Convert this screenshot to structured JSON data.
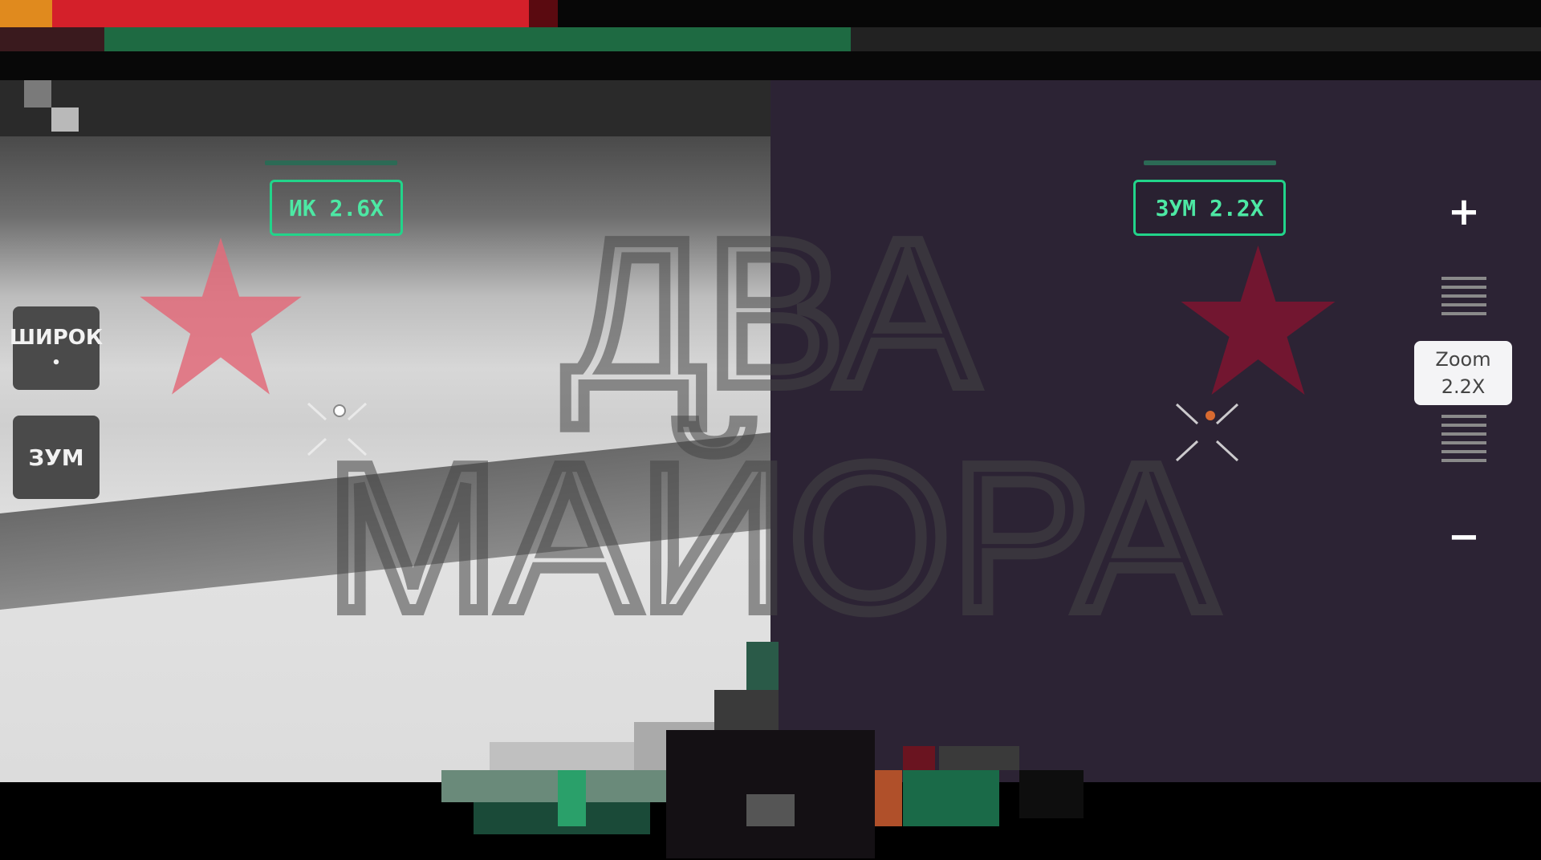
{
  "left_view": {
    "mode_label": "ИК 2.6X",
    "buttons": [
      {
        "label": "ШИРОК",
        "indicator": "•"
      },
      {
        "label": "ЗУМ"
      }
    ]
  },
  "right_view": {
    "mode_label": "ЗУМ 2.2X"
  },
  "zoom_control": {
    "plus": "+",
    "minus": "−",
    "indicator_line1": "Zoom",
    "indicator_line2": "2.2X"
  },
  "watermark": {
    "line1": "ДВА",
    "line2": "МАЙОРА"
  },
  "icons": {
    "left_emblem": "red-star-icon",
    "right_emblem": "red-star-icon",
    "crosshair": "crosshair-icon"
  },
  "colors": {
    "label_border": "#22d48a",
    "label_text": "#4de8a4",
    "status_red": "#d4202a",
    "status_green": "#1e6a42",
    "star_left": "#e26b7a",
    "star_right": "#7a1530"
  }
}
